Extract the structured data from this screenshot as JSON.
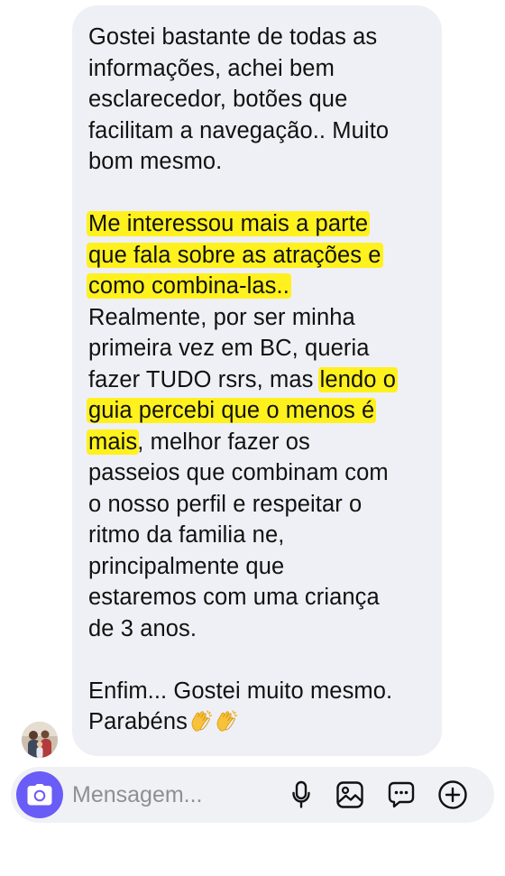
{
  "message": {
    "paragraph1": [
      "Gostei bastante de todas as",
      "informações,  achei bem",
      "esclarecedor, botões que",
      "facilitam a navegação.. Muito",
      "bom mesmo."
    ],
    "paragraph2": {
      "hl_line1": "Me interessou mais a parte",
      "hl_line2": "que fala sobre as atrações e",
      "hl_line3": "como combina-las..",
      "line4": "Realmente, por ser minha",
      "line5": "primeira vez em BC, queria",
      "line6_plain": "fazer TUDO rsrs, mas ",
      "line6_hl": "lendo o",
      "line7_hl": "guia percebi que o menos é",
      "line8_hl": "mais",
      "line8_plain": ", melhor fazer os",
      "line9": "passeios que combinam com",
      "line10": "o nosso perfil e respeitar o",
      "line11": "ritmo da familia ne,",
      "line12": "principalmente que",
      "line13": "estaremos com uma criança",
      "line14": "de 3 anos."
    },
    "paragraph3": {
      "line1": "Enfim... Gostei muito mesmo.",
      "line2": "Parabéns"
    },
    "highlight_color": "#fef11e",
    "bubble_color": "#eff0f5"
  },
  "composer": {
    "placeholder": "Mensagem...",
    "camera_icon": "camera-icon",
    "mic_icon": "microphone-icon",
    "gallery_icon": "gallery-icon",
    "sticker_icon": "sticker-icon",
    "plus_icon": "plus-icon",
    "accent": "#6a5cf6"
  }
}
